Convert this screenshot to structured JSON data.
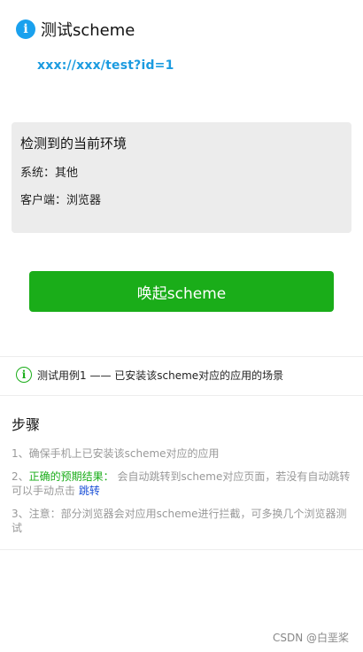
{
  "header": {
    "icon": "info-icon",
    "title": "测试scheme"
  },
  "scheme_url": "xxx://xxx/test?id=1",
  "env": {
    "title": "检测到的当前环境",
    "system": "系统：其他",
    "client": "客户端：浏览器"
  },
  "launch_button": "唤起scheme",
  "test_case": {
    "icon": "info-circle-icon",
    "text": "测试用例1 —— 已安装该scheme对应的应用的场景"
  },
  "steps": {
    "title": "步骤",
    "items": [
      {
        "text": "1、确保手机上已安装该scheme对应的应用"
      },
      {
        "prefix": "2、",
        "highlight": "正确的预期结果：",
        "text": " 会自动跳转到scheme对应页面，若没有自动跳转可以手动点击 ",
        "link": "跳转"
      },
      {
        "text": "3、注意：部分浏览器会对应用scheme进行拦截，可多换几个浏览器测试"
      }
    ]
  },
  "watermark": "CSDN @白垩桨",
  "colors": {
    "accent_green": "#1aad19",
    "accent_blue": "#1aa1ee",
    "link_blue": "#1a4fd6"
  }
}
